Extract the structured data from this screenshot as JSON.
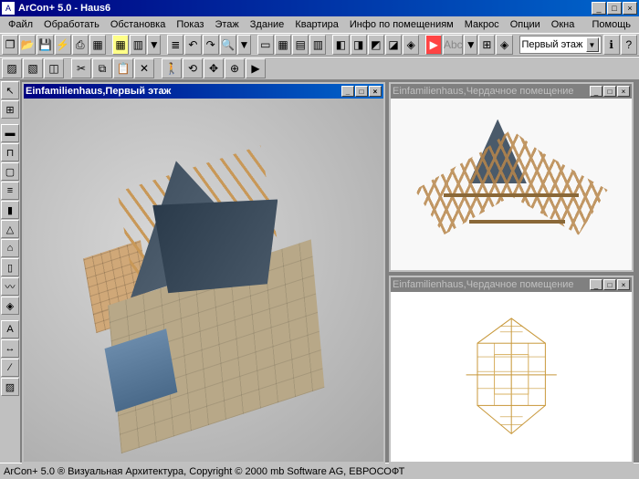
{
  "app": {
    "title": "ArCon+  5.0 - Haus6",
    "help": "Помощь"
  },
  "menu": {
    "items": [
      "Файл",
      "Обработать",
      "Обстановка",
      "Показ",
      "Этаж",
      "Здание",
      "Квартира",
      "Инфо по помещениям",
      "Макрос",
      "Опции",
      "Окна"
    ]
  },
  "toolbar1": {
    "floor_selector": "Первый этаж"
  },
  "windows": {
    "main": {
      "title": "Einfamilienhaus,Первый этаж"
    },
    "attic3d": {
      "title": "Einfamilienhaus,Чердачное помещение"
    },
    "atticplan": {
      "title": "Einfamilienhaus,Чердачное помещение"
    }
  },
  "status": {
    "text": "ArCon+ 5.0 ® Визуальная Архитектура, Copyright © 2000 mb Software AG, ЕВРОСОФТ"
  },
  "icons": {
    "new": "❐",
    "open": "📂",
    "save": "💾",
    "print": "⎙",
    "undo": "↶",
    "redo": "↷",
    "cut": "✂",
    "copy": "⧉",
    "paste": "📋",
    "zoom": "🔍",
    "hand": "✋",
    "arrow": "➤",
    "grid": "▦",
    "layers": "≣",
    "3d": "◈",
    "light": "⚡",
    "color": "▆",
    "help": "?",
    "min": "_",
    "max": "□",
    "close": "×",
    "restore": "❐",
    "down": "▼",
    "cursor": "↖",
    "sel": "▭",
    "wall": "▬",
    "line": "∕",
    "dim": "↔",
    "text": "A",
    "fill": "▨",
    "measure": "⟊"
  }
}
